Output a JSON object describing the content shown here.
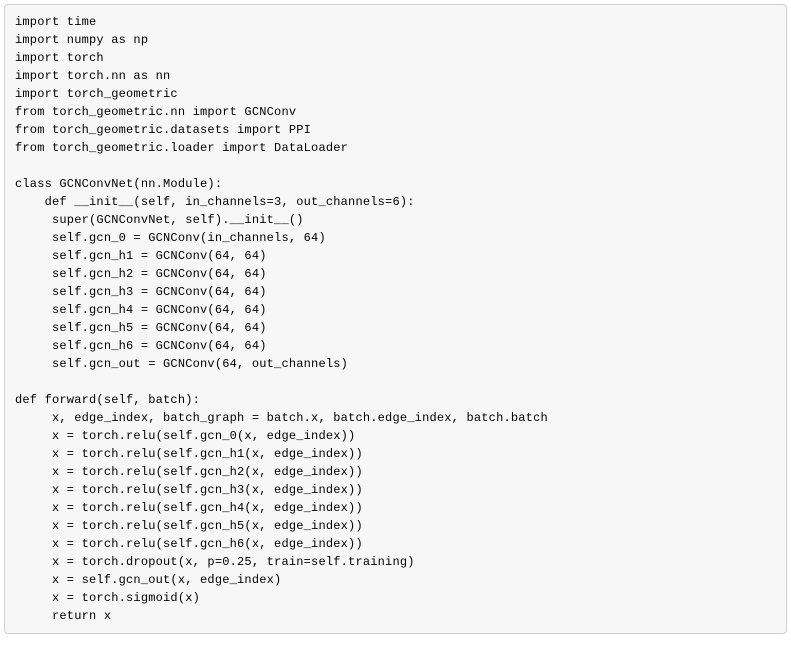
{
  "code": {
    "lines": [
      "import time",
      "import numpy as np",
      "import torch",
      "import torch.nn as nn",
      "import torch_geometric",
      "from torch_geometric.nn import GCNConv",
      "from torch_geometric.datasets import PPI",
      "from torch_geometric.loader import DataLoader",
      "",
      "class GCNConvNet(nn.Module):",
      "    def __init__(self, in_channels=3, out_channels=6):",
      "     super(GCNConvNet, self).__init__()",
      "     self.gcn_0 = GCNConv(in_channels, 64)",
      "     self.gcn_h1 = GCNConv(64, 64)",
      "     self.gcn_h2 = GCNConv(64, 64)",
      "     self.gcn_h3 = GCNConv(64, 64)",
      "     self.gcn_h4 = GCNConv(64, 64)",
      "     self.gcn_h5 = GCNConv(64, 64)",
      "     self.gcn_h6 = GCNConv(64, 64)",
      "     self.gcn_out = GCNConv(64, out_channels)",
      "",
      "def forward(self, batch):",
      "     x, edge_index, batch_graph = batch.x, batch.edge_index, batch.batch",
      "     x = torch.relu(self.gcn_0(x, edge_index))",
      "     x = torch.relu(self.gcn_h1(x, edge_index))",
      "     x = torch.relu(self.gcn_h2(x, edge_index))",
      "     x = torch.relu(self.gcn_h3(x, edge_index))",
      "     x = torch.relu(self.gcn_h4(x, edge_index))",
      "     x = torch.relu(self.gcn_h5(x, edge_index))",
      "     x = torch.relu(self.gcn_h6(x, edge_index))",
      "     x = torch.dropout(x, p=0.25, train=self.training)",
      "     x = self.gcn_out(x, edge_index)",
      "     x = torch.sigmoid(x)",
      "     return x"
    ]
  }
}
